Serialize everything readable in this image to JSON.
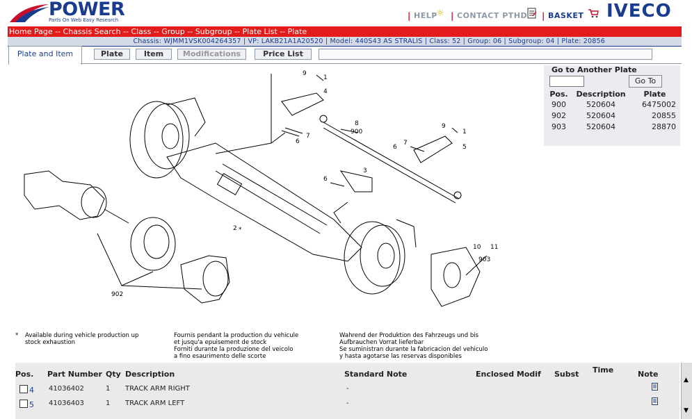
{
  "brand": {
    "name": "POWER",
    "tagline": "Parts On Web Easy Research",
    "partner": "IVECO"
  },
  "top_links": {
    "help": "HELP",
    "contact": "CONTACT PTHD",
    "basket": "BASKET",
    "separator": "|"
  },
  "breadcrumb": "Home Page -- Chassis Search -- Class -- Group -- Subgroup -- Plate List -- Plate",
  "chassis_info": "Chassis: WJMM1VSK004264357 | VP: LAKB21A1A20520 | Model: 440S43 AS STRALIS | Class: 52 | Group: 06 | Subgroup: 04 | Plate: 20856",
  "tabs": {
    "active": "Plate and Item",
    "plate": "Plate",
    "item": "Item",
    "modifications": "Modifications",
    "price_list": "Price List"
  },
  "goto_plate": {
    "title": "Go to Another Plate",
    "input_value": "",
    "button": "Go To",
    "headers": [
      "Pos.",
      "Description",
      "Plate"
    ],
    "rows": [
      [
        "900",
        "520604",
        "6475002"
      ],
      [
        "902",
        "520604",
        "20855"
      ],
      [
        "903",
        "520604",
        "28870"
      ]
    ]
  },
  "drawing": {
    "callouts": [
      "9",
      "1",
      "4",
      "8",
      "900",
      "7",
      "6",
      "9",
      "1",
      "7",
      "6",
      "5",
      "3",
      "6",
      "2",
      "10",
      "11",
      "903",
      "902",
      "*"
    ],
    "notes": [
      [
        "Available during vehicle production up",
        "stock exhaustion"
      ],
      [
        "Fournis pendant la production du vehicule",
        "et jusqu'a epuisement de stock",
        "Forniti durante la produzione del veicolo",
        "a fino esaurimento delle scorte"
      ],
      [
        "Wahrend der Produktion des Fahrzeugs und bis",
        "Aufbrauchen Vorrat lieferbar",
        "Se suministran durante la fabricacion del vehiculo",
        "y hasta agotarse las reservas disponibles"
      ]
    ],
    "asterisk": "*"
  },
  "parts_table": {
    "headers": {
      "pos": "Pos.",
      "part_number": "Part Number",
      "qty": "Qty",
      "description": "Description",
      "standard_note": "Standard Note",
      "enclosed_modif": "Enclosed Modif",
      "subst": "Subst",
      "time": "Time",
      "note": "Note"
    },
    "rows": [
      {
        "pos": "4",
        "part_number": "41036402",
        "qty": "1",
        "description": "TRACK ARM RIGHT",
        "standard_note": "-"
      },
      {
        "pos": "5",
        "part_number": "41036403",
        "qty": "1",
        "description": "TRACK ARM LEFT",
        "standard_note": "-"
      }
    ]
  },
  "colors": {
    "brand_blue": "#1a3c8f",
    "bar_red": "#e41b1b",
    "info_bar": "#d4dae6"
  }
}
